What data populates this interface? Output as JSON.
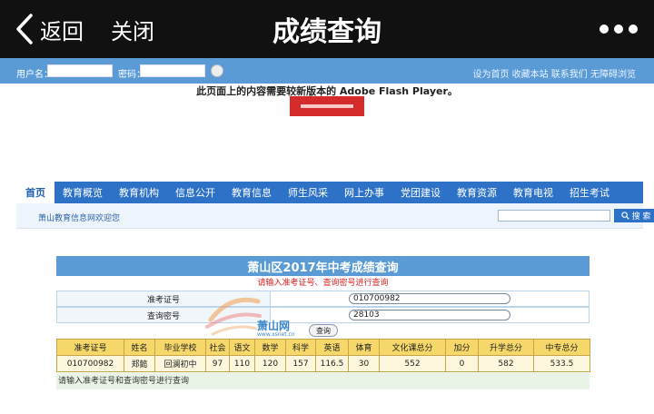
{
  "appbar": {
    "back_label": "返回",
    "close_label": "关闭",
    "title": "成绩查询"
  },
  "login": {
    "username_label": "用户名：",
    "password_label": "密码：",
    "go_icon": "submit-icon",
    "links": "设为首页  收藏本站  联系我们  无障碍浏览"
  },
  "flash": {
    "notice": "此页面上的内容需要较新版本的 Adobe Flash Player。",
    "logo": "adobe-logo"
  },
  "nav": {
    "items": [
      "首页",
      "教育概览",
      "教育机构",
      "信息公开",
      "教育信息",
      "师生风采",
      "网上办事",
      "党团建设",
      "教育资源",
      "教育电视",
      "招生考试"
    ],
    "welcome": "萧山教育信息网欢迎您",
    "search_button": "搜 索"
  },
  "query": {
    "title": "萧山区2017年中考成绩查询",
    "hint_top": "请输入准考证号、查询密号进行查询",
    "exam_no_label": "准考证号",
    "exam_no_value": "010700982",
    "password_label": "查询密号",
    "password_value": "28103",
    "submit_label": "查询",
    "hint_bottom": "请输入准考证号和查询密号进行查询",
    "watermark": {
      "main": "萧山网",
      "sub": "www.xsnet.cn"
    }
  },
  "results": {
    "headers": [
      "准考证号",
      "姓名",
      "毕业学校",
      "社会",
      "语文",
      "数学",
      "科学",
      "英语",
      "体育",
      "文化课总分",
      "加分",
      "升学总分",
      "中专总分"
    ],
    "row": [
      "010700982",
      "郑懿",
      "回澜初中",
      "97",
      "110",
      "120",
      "157",
      "116.5",
      "30",
      "552",
      "0",
      "582",
      "533.5"
    ]
  },
  "colors": {
    "appbar": "#111111",
    "nav": "#2e72c8",
    "header_bar": "#5a9bd6",
    "table_header": "#f6d86a",
    "hint_red": "#dd2222"
  }
}
